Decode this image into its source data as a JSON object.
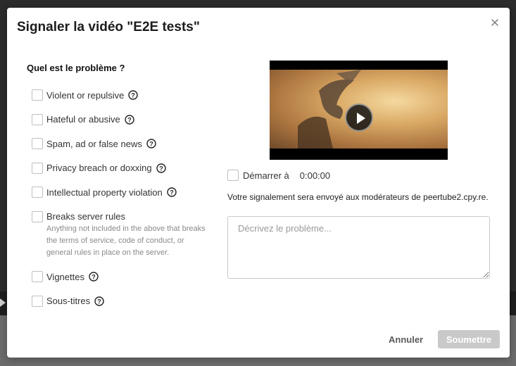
{
  "dialog": {
    "title": "Signaler la vidéo \"E2E tests\"",
    "close_icon": "close-icon"
  },
  "form": {
    "question": "Quel est le problème ?",
    "options": [
      {
        "label": "Violent or repulsive",
        "has_help": true
      },
      {
        "label": "Hateful or abusive",
        "has_help": true
      },
      {
        "label": "Spam, ad or false news",
        "has_help": true
      },
      {
        "label": "Privacy breach or doxxing",
        "has_help": true
      },
      {
        "label": "Intellectual property violation",
        "has_help": true
      },
      {
        "label": "Breaks server rules",
        "has_help": false,
        "description": "Anything not included in the above that breaks the terms of service, code of conduct, or general rules in place on the server."
      },
      {
        "label": "Vignettes",
        "has_help": true
      },
      {
        "label": "Sous-titres",
        "has_help": true
      }
    ]
  },
  "video": {
    "play_icon": "play-icon"
  },
  "start": {
    "label": "Démarrer à",
    "time": "0:00:00"
  },
  "notice": "Votre signalement sera envoyé aux modérateurs de peertube2.cpy.re.",
  "description": {
    "placeholder": "Décrivez le problème...",
    "value": ""
  },
  "buttons": {
    "cancel": "Annuler",
    "submit": "Soumettre"
  },
  "colors": {
    "submit_disabled": "#c9c9c9",
    "backdrop": "#2b2b2b"
  }
}
